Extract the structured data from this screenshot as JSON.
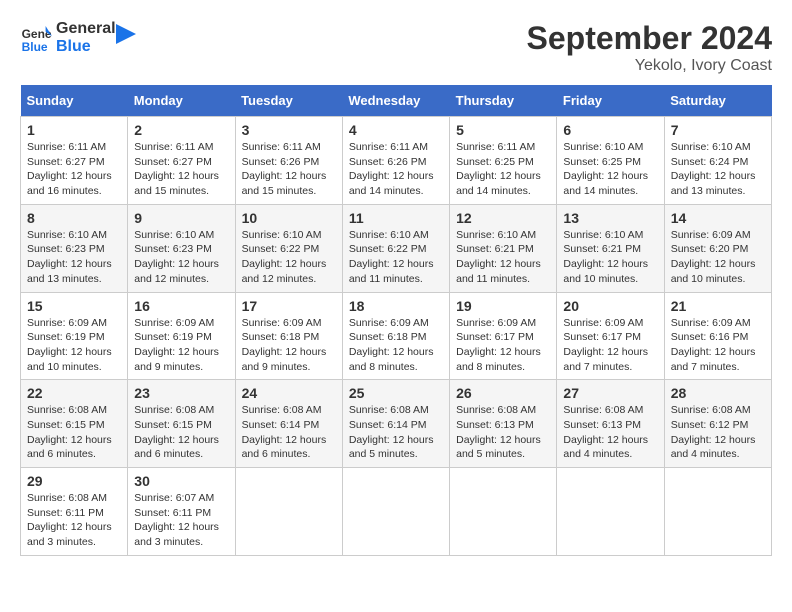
{
  "header": {
    "logo_line1": "General",
    "logo_line2": "Blue",
    "title": "September 2024",
    "subtitle": "Yekolo, Ivory Coast"
  },
  "calendar": {
    "days_of_week": [
      "Sunday",
      "Monday",
      "Tuesday",
      "Wednesday",
      "Thursday",
      "Friday",
      "Saturday"
    ],
    "weeks": [
      [
        {
          "day": "1",
          "info": "Sunrise: 6:11 AM\nSunset: 6:27 PM\nDaylight: 12 hours\nand 16 minutes."
        },
        {
          "day": "2",
          "info": "Sunrise: 6:11 AM\nSunset: 6:27 PM\nDaylight: 12 hours\nand 15 minutes."
        },
        {
          "day": "3",
          "info": "Sunrise: 6:11 AM\nSunset: 6:26 PM\nDaylight: 12 hours\nand 15 minutes."
        },
        {
          "day": "4",
          "info": "Sunrise: 6:11 AM\nSunset: 6:26 PM\nDaylight: 12 hours\nand 14 minutes."
        },
        {
          "day": "5",
          "info": "Sunrise: 6:11 AM\nSunset: 6:25 PM\nDaylight: 12 hours\nand 14 minutes."
        },
        {
          "day": "6",
          "info": "Sunrise: 6:10 AM\nSunset: 6:25 PM\nDaylight: 12 hours\nand 14 minutes."
        },
        {
          "day": "7",
          "info": "Sunrise: 6:10 AM\nSunset: 6:24 PM\nDaylight: 12 hours\nand 13 minutes."
        }
      ],
      [
        {
          "day": "8",
          "info": "Sunrise: 6:10 AM\nSunset: 6:23 PM\nDaylight: 12 hours\nand 13 minutes."
        },
        {
          "day": "9",
          "info": "Sunrise: 6:10 AM\nSunset: 6:23 PM\nDaylight: 12 hours\nand 12 minutes."
        },
        {
          "day": "10",
          "info": "Sunrise: 6:10 AM\nSunset: 6:22 PM\nDaylight: 12 hours\nand 12 minutes."
        },
        {
          "day": "11",
          "info": "Sunrise: 6:10 AM\nSunset: 6:22 PM\nDaylight: 12 hours\nand 11 minutes."
        },
        {
          "day": "12",
          "info": "Sunrise: 6:10 AM\nSunset: 6:21 PM\nDaylight: 12 hours\nand 11 minutes."
        },
        {
          "day": "13",
          "info": "Sunrise: 6:10 AM\nSunset: 6:21 PM\nDaylight: 12 hours\nand 10 minutes."
        },
        {
          "day": "14",
          "info": "Sunrise: 6:09 AM\nSunset: 6:20 PM\nDaylight: 12 hours\nand 10 minutes."
        }
      ],
      [
        {
          "day": "15",
          "info": "Sunrise: 6:09 AM\nSunset: 6:19 PM\nDaylight: 12 hours\nand 10 minutes."
        },
        {
          "day": "16",
          "info": "Sunrise: 6:09 AM\nSunset: 6:19 PM\nDaylight: 12 hours\nand 9 minutes."
        },
        {
          "day": "17",
          "info": "Sunrise: 6:09 AM\nSunset: 6:18 PM\nDaylight: 12 hours\nand 9 minutes."
        },
        {
          "day": "18",
          "info": "Sunrise: 6:09 AM\nSunset: 6:18 PM\nDaylight: 12 hours\nand 8 minutes."
        },
        {
          "day": "19",
          "info": "Sunrise: 6:09 AM\nSunset: 6:17 PM\nDaylight: 12 hours\nand 8 minutes."
        },
        {
          "day": "20",
          "info": "Sunrise: 6:09 AM\nSunset: 6:17 PM\nDaylight: 12 hours\nand 7 minutes."
        },
        {
          "day": "21",
          "info": "Sunrise: 6:09 AM\nSunset: 6:16 PM\nDaylight: 12 hours\nand 7 minutes."
        }
      ],
      [
        {
          "day": "22",
          "info": "Sunrise: 6:08 AM\nSunset: 6:15 PM\nDaylight: 12 hours\nand 6 minutes."
        },
        {
          "day": "23",
          "info": "Sunrise: 6:08 AM\nSunset: 6:15 PM\nDaylight: 12 hours\nand 6 minutes."
        },
        {
          "day": "24",
          "info": "Sunrise: 6:08 AM\nSunset: 6:14 PM\nDaylight: 12 hours\nand 6 minutes."
        },
        {
          "day": "25",
          "info": "Sunrise: 6:08 AM\nSunset: 6:14 PM\nDaylight: 12 hours\nand 5 minutes."
        },
        {
          "day": "26",
          "info": "Sunrise: 6:08 AM\nSunset: 6:13 PM\nDaylight: 12 hours\nand 5 minutes."
        },
        {
          "day": "27",
          "info": "Sunrise: 6:08 AM\nSunset: 6:13 PM\nDaylight: 12 hours\nand 4 minutes."
        },
        {
          "day": "28",
          "info": "Sunrise: 6:08 AM\nSunset: 6:12 PM\nDaylight: 12 hours\nand 4 minutes."
        }
      ],
      [
        {
          "day": "29",
          "info": "Sunrise: 6:08 AM\nSunset: 6:11 PM\nDaylight: 12 hours\nand 3 minutes."
        },
        {
          "day": "30",
          "info": "Sunrise: 6:07 AM\nSunset: 6:11 PM\nDaylight: 12 hours\nand 3 minutes."
        },
        {
          "day": "",
          "info": ""
        },
        {
          "day": "",
          "info": ""
        },
        {
          "day": "",
          "info": ""
        },
        {
          "day": "",
          "info": ""
        },
        {
          "day": "",
          "info": ""
        }
      ]
    ]
  }
}
